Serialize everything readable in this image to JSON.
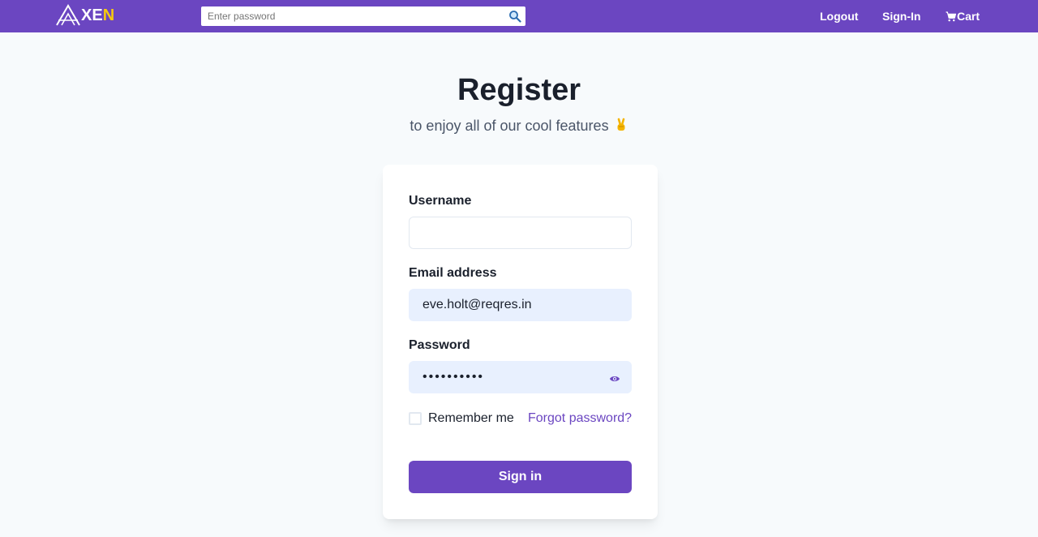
{
  "navbar": {
    "logo_text_white": "XE",
    "logo_text_accent": "N",
    "search_placeholder": "Enter password",
    "search_value": "",
    "logout_label": "Logout",
    "signin_label": "Sign-In",
    "cart_label": "Cart",
    "bg_color": "#6b46c1",
    "logo_accent_color": "#f6c90e"
  },
  "header": {
    "title": "Register",
    "subtitle": "to enjoy all of our cool features",
    "subtitle_emoji": "victory-hand-icon"
  },
  "form": {
    "username_label": "Username",
    "username_value": "",
    "email_label": "Email address",
    "email_value": "eve.holt@reqres.in",
    "password_label": "Password",
    "password_value": "••••••••••",
    "remember_label": "Remember me",
    "remember_checked": false,
    "forgot_label": "Forgot password?",
    "submit_label": "Sign in",
    "accent_color": "#6b46c1",
    "autofill_color": "#e8f0fe"
  }
}
